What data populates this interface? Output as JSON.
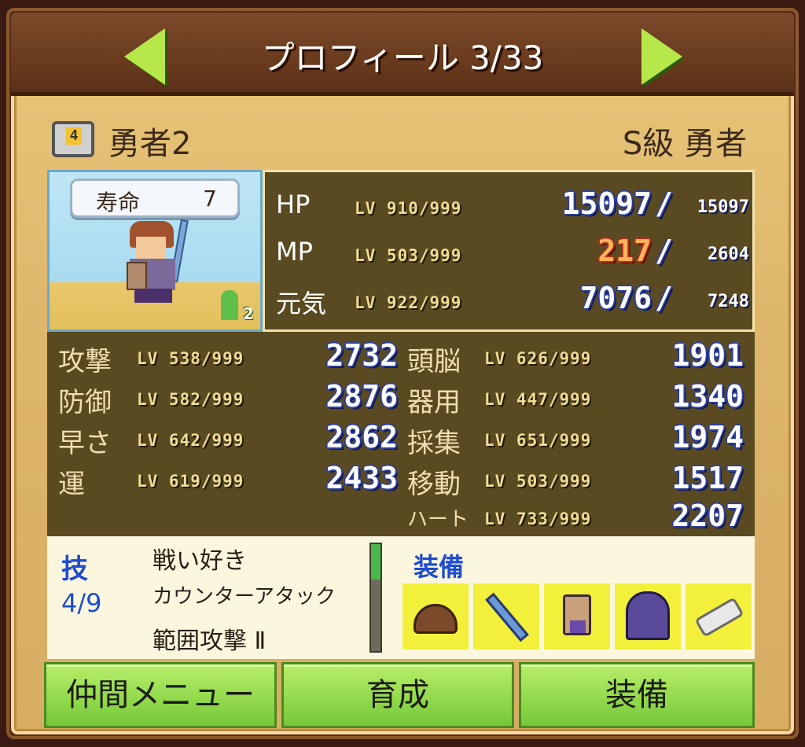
{
  "header": {
    "title": "プロフィール  3/33",
    "prev_icon": "left-arrow",
    "next_icon": "right-arrow"
  },
  "unit": {
    "name": "勇者2",
    "class": "S級  勇者",
    "life_label": "寿命",
    "life_value": "7",
    "party_count": "2"
  },
  "vitals": [
    {
      "label": "HP",
      "lv": "LV 910/999",
      "current": "15097",
      "max": "15097",
      "alert": false
    },
    {
      "label": "MP",
      "lv": "LV 503/999",
      "current": "217",
      "max": "2604",
      "alert": true
    },
    {
      "label": "元気",
      "lv": "LV 922/999",
      "current": "7076",
      "max": "7248",
      "alert": false
    }
  ],
  "stats_left": [
    {
      "label": "攻撃",
      "lv": "LV 538/999",
      "value": "2732"
    },
    {
      "label": "防御",
      "lv": "LV 582/999",
      "value": "2876"
    },
    {
      "label": "早さ",
      "lv": "LV 642/999",
      "value": "2862"
    },
    {
      "label": "運",
      "lv": "LV 619/999",
      "value": "2433"
    }
  ],
  "stats_right": [
    {
      "label": "頭脳",
      "lv": "LV 626/999",
      "value": "1901"
    },
    {
      "label": "器用",
      "lv": "LV 447/999",
      "value": "1340"
    },
    {
      "label": "採集",
      "lv": "LV 651/999",
      "value": "1974"
    },
    {
      "label": "移動",
      "lv": "LV 503/999",
      "value": "1517"
    },
    {
      "label": "ハート",
      "lv": "LV 733/999",
      "value": "2207"
    }
  ],
  "skills": {
    "title": "技",
    "count": "4/9",
    "items": [
      "戦い好き",
      "カウンターアタック",
      "範囲攻撃 Ⅱ"
    ],
    "scroll_fraction": 0.33
  },
  "equipment": {
    "title": "装備",
    "items": [
      "helmet-icon",
      "sword-icon",
      "armor-icon",
      "cloak-icon",
      "boots-icon"
    ]
  },
  "buttons": {
    "party_menu": "仲間メニュー",
    "train": "育成",
    "equip": "装備"
  },
  "colors": {
    "accent_blue": "#1e4bd1",
    "button_green": "#8fd84a",
    "panel_bg": "#dcb46a",
    "stat_bg": "#5a4a22"
  }
}
